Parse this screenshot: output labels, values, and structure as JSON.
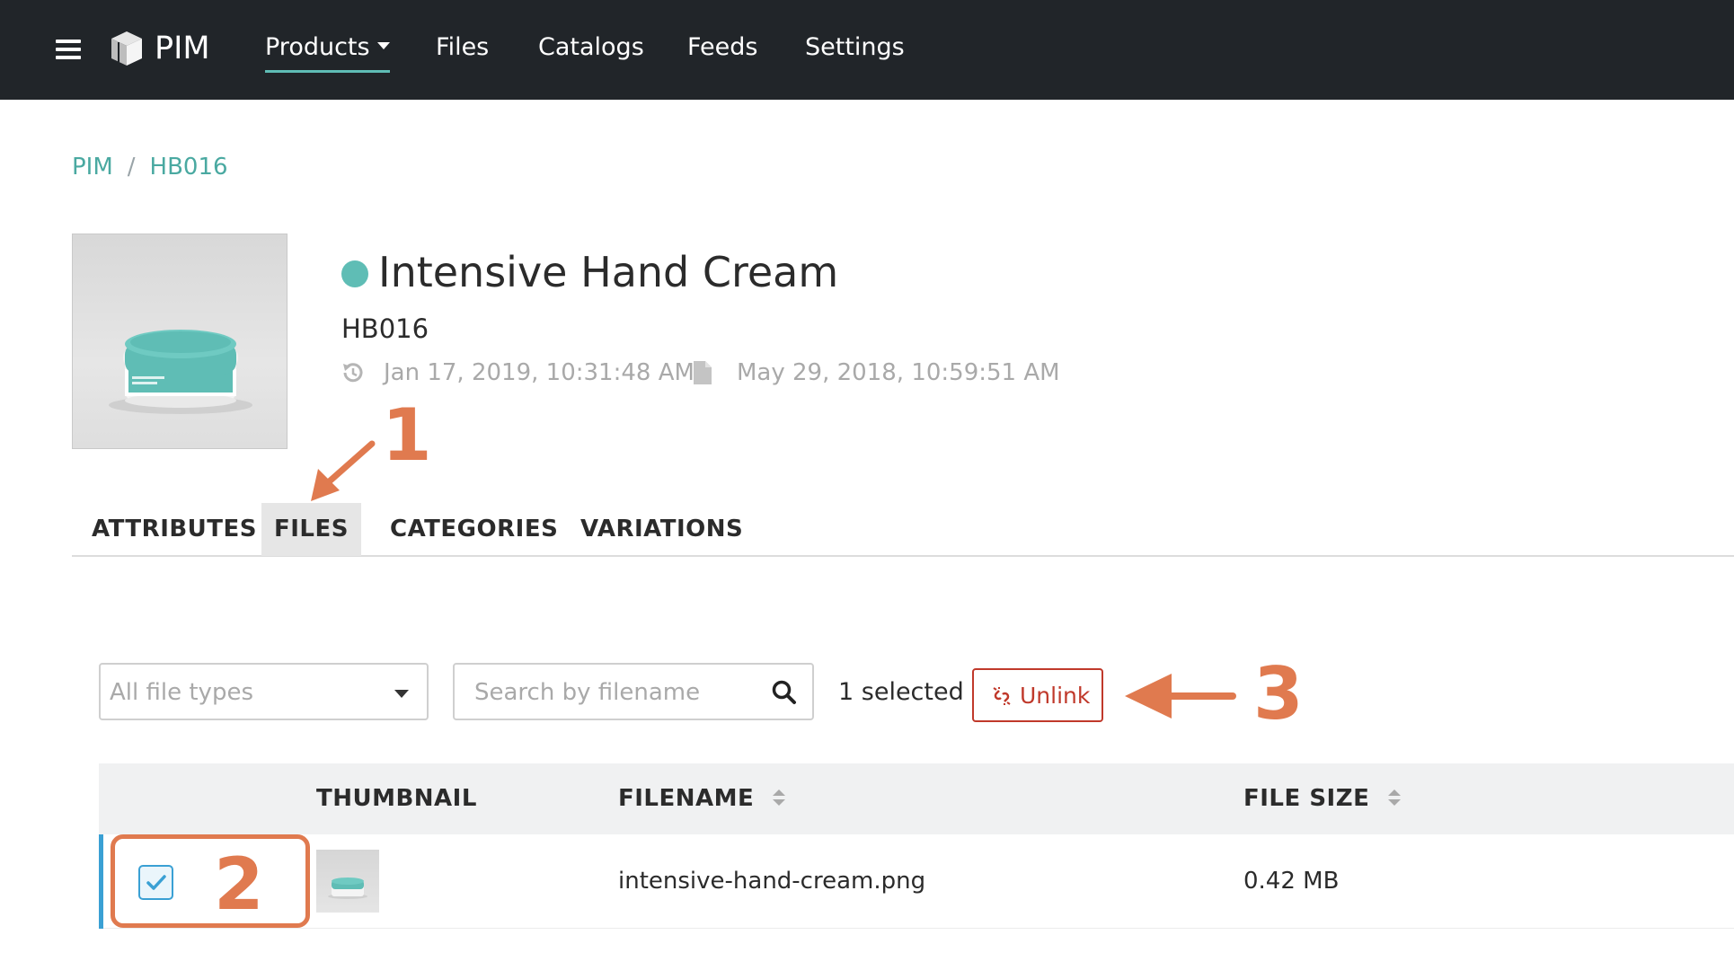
{
  "nav": {
    "brand": "PIM",
    "items": {
      "products": "Products",
      "files": "Files",
      "catalogs": "Catalogs",
      "feeds": "Feeds",
      "settings": "Settings"
    }
  },
  "breadcrumb": {
    "root": "PIM",
    "separator": "/",
    "current": "HB016"
  },
  "product": {
    "title": "Intensive Hand Cream",
    "sku": "HB016",
    "status_color": "#5fbdb5",
    "updated_at": "Jan 17, 2019, 10:31:48 AM",
    "created_at": "May 29, 2018, 10:59:51 AM",
    "updated_icon": "history-icon",
    "created_icon": "document-icon"
  },
  "tabs": {
    "attributes": "ATTRIBUTES",
    "files": "FILES",
    "categories": "CATEGORIES",
    "variations": "VARIATIONS",
    "active": "FILES"
  },
  "toolbar": {
    "filetype_value": "All file types",
    "search_placeholder": "Search by filename",
    "selected_count": "1 selected",
    "unlink_label": "Unlink"
  },
  "table": {
    "headers": {
      "thumbnail": "THUMBNAIL",
      "filename": "FILENAME",
      "filesize": "FILE SIZE"
    },
    "rows": [
      {
        "selected": true,
        "filename": "intensive-hand-cream.png",
        "filesize": "0.42 MB"
      }
    ]
  },
  "annotations": {
    "step1": "1",
    "step2": "2",
    "step3": "3",
    "color": "#e07a4f"
  },
  "colors": {
    "topbar": "#212529",
    "accent": "#5fbdb5",
    "danger": "#c0392b",
    "selection": "#3aa0d4"
  }
}
